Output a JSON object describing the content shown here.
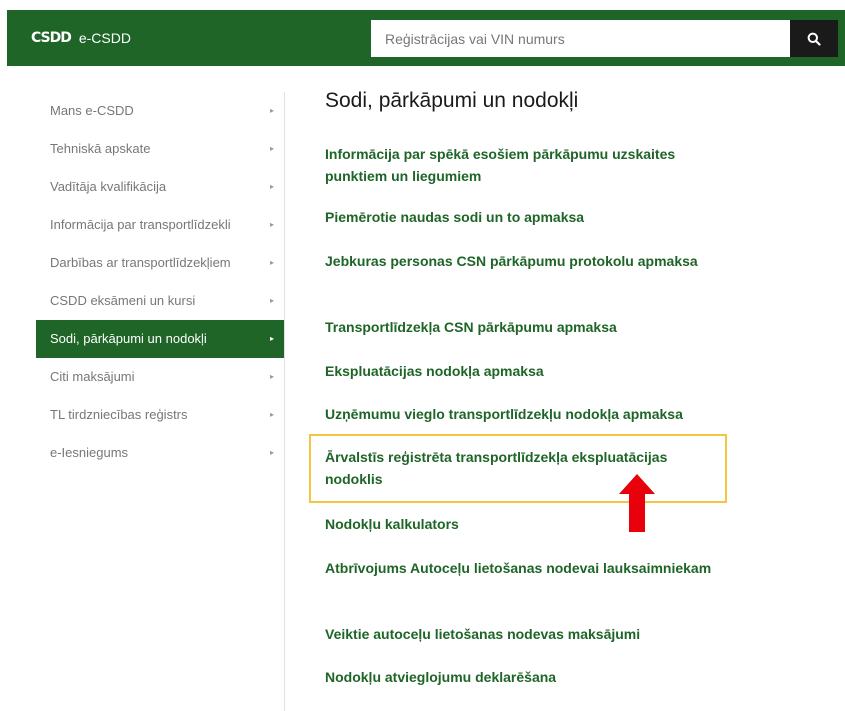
{
  "header": {
    "logo_mark": "CSDD",
    "logo_text": "e-CSDD",
    "search_placeholder": "Reģistrācijas vai VIN numurs"
  },
  "sidebar": {
    "items": [
      {
        "label": "Mans e-CSDD"
      },
      {
        "label": "Tehniskā apskate"
      },
      {
        "label": "Vadītāja kvalifikācija"
      },
      {
        "label": "Informācija par transportlīdzekli"
      },
      {
        "label": "Darbības ar transportlīdzekļiem"
      },
      {
        "label": "CSDD eksāmeni un kursi"
      },
      {
        "label": "Sodi, pārkāpumi un nodokļi"
      },
      {
        "label": "Citi maksājumi"
      },
      {
        "label": "TL tirdzniecības reģistrs"
      },
      {
        "label": "e-Iesniegums"
      }
    ],
    "arrow": "▸"
  },
  "main": {
    "title": "Sodi, pārkāpumi un nodokļi",
    "links": [
      {
        "label": "Informācija par spēkā esošiem pārkāpumu uzskaites punktiem un liegumiem"
      },
      {
        "label": "Piemērotie naudas sodi un to apmaksa"
      },
      {
        "label": "Jebkuras personas CSN pārkāpumu protokolu apmaksa"
      },
      {
        "label": "Transportlīdzekļa CSN pārkāpumu apmaksa"
      },
      {
        "label": "Ekspluatācijas nodokļa apmaksa"
      },
      {
        "label": "Uzņēmumu vieglo transportlīdzekļu nodokļa apmaksa"
      },
      {
        "label": "Ārvalstīs reģistrēta transportlīdzekļa ekspluatācijas nodoklis"
      },
      {
        "label": "Nodokļu kalkulators"
      },
      {
        "label": "Atbrīvojums Autoceļu lietošanas nodevai lauksaimniekam"
      },
      {
        "label": "Veiktie autoceļu lietošanas nodevas maksājumi"
      },
      {
        "label": "Nodokļu atvieglojumu deklarēšana"
      }
    ]
  },
  "colors": {
    "brand_green": "#1e6527",
    "highlight": "#f5c542",
    "arrow_red": "#e8000b"
  }
}
